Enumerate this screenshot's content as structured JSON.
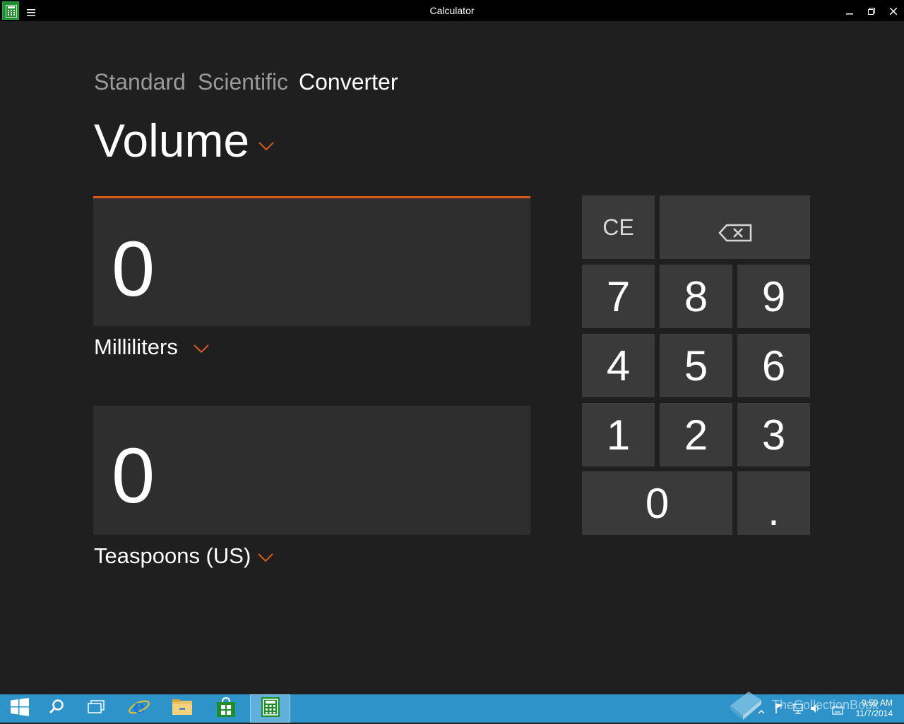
{
  "window": {
    "title": "Calculator",
    "icons": {
      "app": "calculator-icon",
      "menu": "hamburger-menu-icon",
      "minimize": "minimize-icon",
      "restore": "restore-icon",
      "close": "close-icon"
    }
  },
  "tabs": [
    {
      "label": "Standard",
      "active": false
    },
    {
      "label": "Scientific",
      "active": false
    },
    {
      "label": "Converter",
      "active": true
    }
  ],
  "category": {
    "label": "Volume",
    "icon": "chevron-down-icon"
  },
  "converter": {
    "from": {
      "value": "0",
      "unit": "Milliliters"
    },
    "to": {
      "value": "0",
      "unit": "Teaspoons (US)"
    }
  },
  "keypad": {
    "clear_entry": "CE",
    "backspace_icon": "backspace-icon",
    "digits": {
      "k7": "7",
      "k8": "8",
      "k9": "9",
      "k4": "4",
      "k5": "5",
      "k6": "6",
      "k1": "1",
      "k2": "2",
      "k3": "3",
      "k0": "0",
      "dot": "."
    }
  },
  "taskbar": {
    "items": [
      {
        "icon": "windows-start-icon"
      },
      {
        "icon": "search-icon"
      },
      {
        "icon": "task-view-icon"
      },
      {
        "icon": "internet-explorer-icon"
      },
      {
        "icon": "file-explorer-icon"
      },
      {
        "icon": "store-icon"
      },
      {
        "icon": "calculator-icon",
        "active": true
      }
    ],
    "watermark": "TheCollectionBook",
    "clock": {
      "time": "9:59 AM",
      "date": "11/7/2014"
    }
  },
  "colors": {
    "accent": "#d85b1c",
    "background": "#1f1f1f",
    "box": "#2e2e2e",
    "key": "#3a3a3a",
    "taskbar": "#2e93c8"
  }
}
